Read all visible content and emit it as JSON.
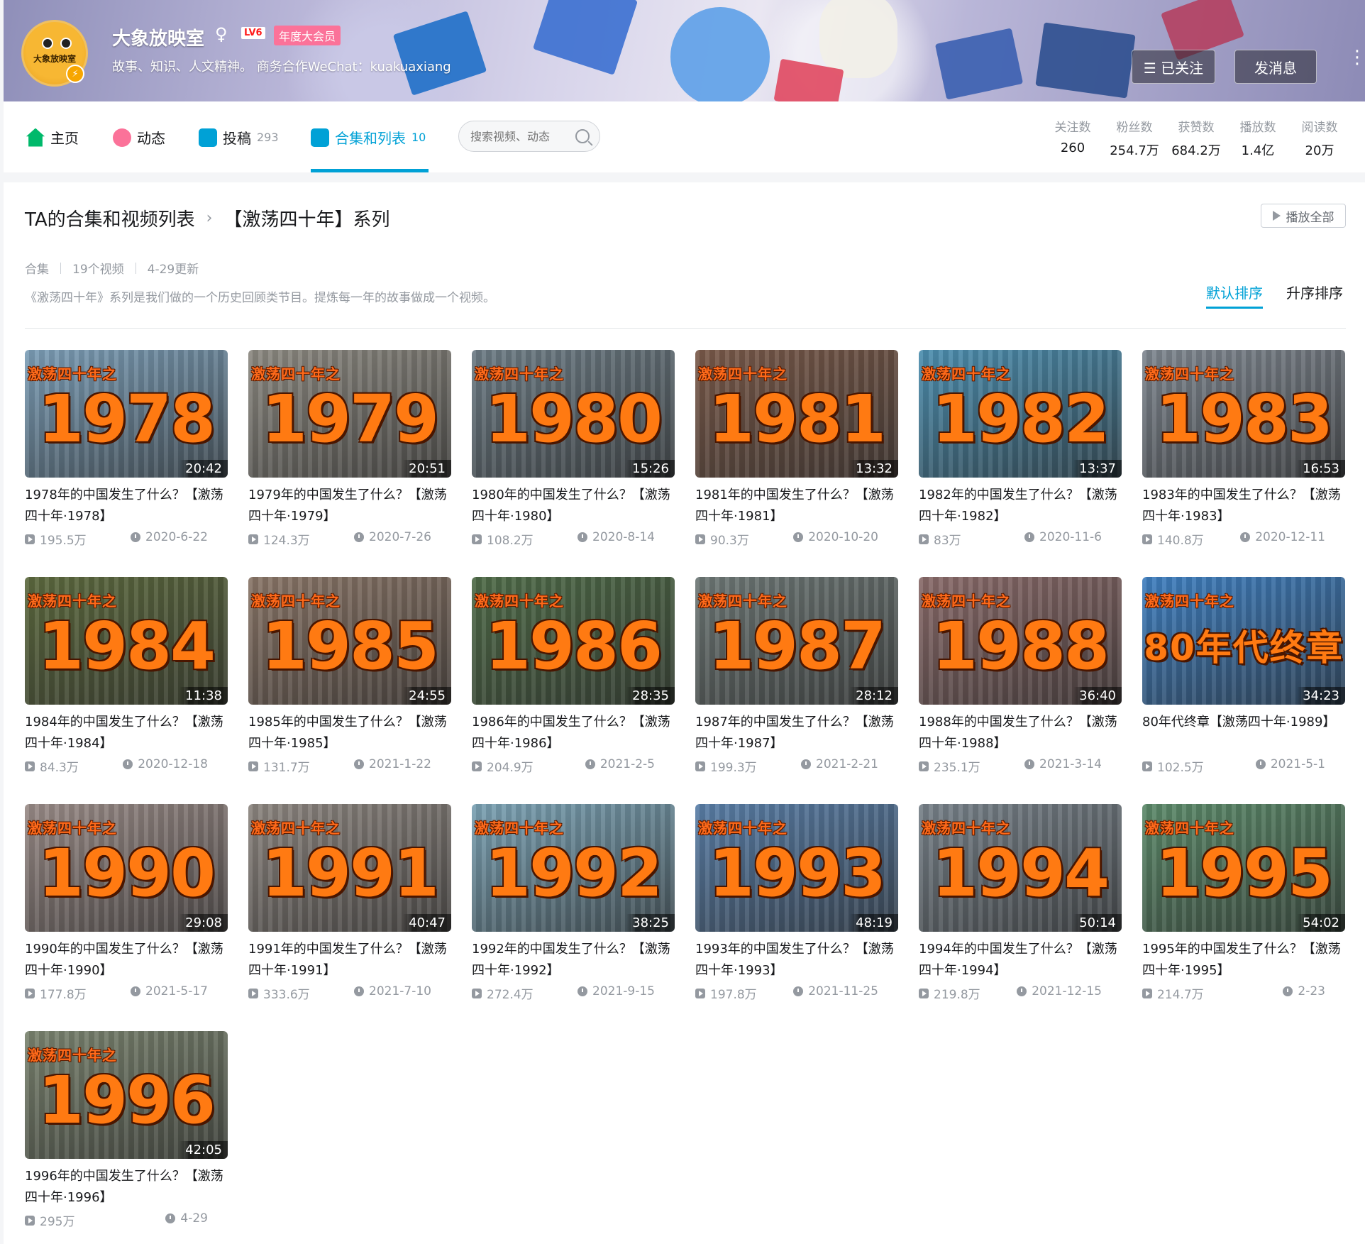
{
  "header": {
    "username": "大象放映室",
    "gender_symbol": "♀",
    "level": "LV6",
    "vip_label": "年度大会员",
    "sign": "故事、知识、人文精神。 商务合作WeChat：kuakuaxiang",
    "avatar_text": "大象放映室",
    "follow_label": "☰ 已关注",
    "message_label": "发消息",
    "more_label": "⋮"
  },
  "nav": {
    "items": [
      {
        "label": "主页",
        "count": ""
      },
      {
        "label": "动态",
        "count": ""
      },
      {
        "label": "投稿",
        "count": "293"
      },
      {
        "label": "合集和列表",
        "count": "10"
      }
    ],
    "search_placeholder": "搜索视频、动态"
  },
  "stats": [
    {
      "label": "关注数",
      "value": "260"
    },
    {
      "label": "粉丝数",
      "value": "254.7万"
    },
    {
      "label": "获赞数",
      "value": "684.2万"
    },
    {
      "label": "播放数",
      "value": "1.4亿"
    },
    {
      "label": "阅读数",
      "value": "20万"
    }
  ],
  "collection": {
    "crumb_root": "TA的合集和视频列表",
    "crumb_sep": "›",
    "title": "【激荡四十年】系列",
    "play_all": "播放全部",
    "type": "合集",
    "video_count": "19个视频",
    "updated": "4-29更新",
    "description": "《激荡四十年》系列是我们做的一个历史回顾类节目。提炼每一年的故事做成一个视频。",
    "sort_default": "默认排序",
    "sort_asc": "升序排序"
  },
  "thumb_series_text": "激荡四十年之",
  "videos": [
    {
      "thumb_text": "1978",
      "duration": "20:42",
      "title": "1978年的中国发生了什么？【激荡四十年·1978】",
      "views": "195.5万",
      "date": "2020-6-22",
      "bg": "#7d9fb8"
    },
    {
      "thumb_text": "1979",
      "duration": "20:51",
      "title": "1979年的中国发生了什么？【激荡四十年·1979】",
      "views": "124.3万",
      "date": "2020-7-26",
      "bg": "#8d8a82"
    },
    {
      "thumb_text": "1980",
      "duration": "15:26",
      "title": "1980年的中国发生了什么？【激荡四十年·1980】",
      "views": "108.2万",
      "date": "2020-8-14",
      "bg": "#6d7c85"
    },
    {
      "thumb_text": "1981",
      "duration": "13:32",
      "title": "1981年的中国发生了什么？【激荡四十年·1981】",
      "views": "90.3万",
      "date": "2020-10-20",
      "bg": "#7a5a4a"
    },
    {
      "thumb_text": "1982",
      "duration": "13:37",
      "title": "1982年的中国发生了什么？【激荡四十年·1982】",
      "views": "83万",
      "date": "2020-11-6",
      "bg": "#4d8fb0"
    },
    {
      "thumb_text": "1983",
      "duration": "16:53",
      "title": "1983年的中国发生了什么？【激荡四十年·1983】",
      "views": "140.8万",
      "date": "2020-12-11",
      "bg": "#7f8790"
    },
    {
      "thumb_text": "1984",
      "duration": "11:38",
      "title": "1984年的中国发生了什么？【激荡四十年·1984】",
      "views": "84.3万",
      "date": "2020-12-18",
      "bg": "#5d6a3f"
    },
    {
      "thumb_text": "1985",
      "duration": "24:55",
      "title": "1985年的中国发生了什么？【激荡四十年·1985】",
      "views": "131.7万",
      "date": "2021-1-22",
      "bg": "#8a7668"
    },
    {
      "thumb_text": "1986",
      "duration": "28:35",
      "title": "1986年的中国发生了什么？【激荡四十年·1986】",
      "views": "204.9万",
      "date": "2021-2-5",
      "bg": "#4f6b48"
    },
    {
      "thumb_text": "1987",
      "duration": "28:12",
      "title": "1987年的中国发生了什么？【激荡四十年·1987】",
      "views": "199.3万",
      "date": "2021-2-21",
      "bg": "#6e7876"
    },
    {
      "thumb_text": "1988",
      "duration": "36:40",
      "title": "1988年的中国发生了什么？【激荡四十年·1988】",
      "views": "235.1万",
      "date": "2021-3-14",
      "bg": "#8a6b6a"
    },
    {
      "thumb_text": "80年代终章",
      "duration": "34:23",
      "title": "80年代终章【激荡四十年·1989】",
      "views": "102.5万",
      "date": "2021-5-1",
      "bg": "#3f7fc0"
    },
    {
      "thumb_text": "1990",
      "duration": "29:08",
      "title": "1990年的中国发生了什么？【激荡四十年·1990】",
      "views": "177.8万",
      "date": "2021-5-17",
      "bg": "#9a8c88"
    },
    {
      "thumb_text": "1991",
      "duration": "40:47",
      "title": "1991年的中国发生了什么？【激荡四十年·1991】",
      "views": "333.6万",
      "date": "2021-7-10",
      "bg": "#8d8680"
    },
    {
      "thumb_text": "1992",
      "duration": "38:25",
      "title": "1992年的中国发生了什么？【激荡四十年·1992】",
      "views": "272.4万",
      "date": "2021-9-15",
      "bg": "#7ba2b4"
    },
    {
      "thumb_text": "1993",
      "duration": "48:19",
      "title": "1993年的中国发生了什么？【激荡四十年·1993】",
      "views": "197.8万",
      "date": "2021-11-25",
      "bg": "#5a7fa8"
    },
    {
      "thumb_text": "1994",
      "duration": "50:14",
      "title": "1994年的中国发生了什么？【激荡四十年·1994】",
      "views": "219.8万",
      "date": "2021-12-15",
      "bg": "#78828a"
    },
    {
      "thumb_text": "1995",
      "duration": "54:02",
      "title": "1995年的中国发生了什么？【激荡四十年·1995】",
      "views": "214.7万",
      "date": "2-23",
      "bg": "#5c8a6a"
    },
    {
      "thumb_text": "1996",
      "duration": "42:05",
      "title": "1996年的中国发生了什么？【激荡四十年·1996】",
      "views": "295万",
      "date": "4-29",
      "bg": "#7b8470"
    }
  ]
}
